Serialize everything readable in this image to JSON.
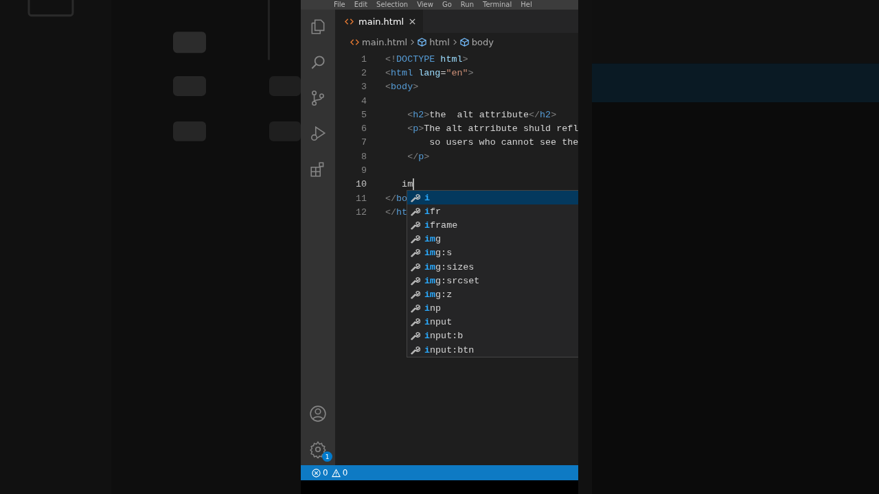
{
  "menu": [
    "File",
    "Edit",
    "Selection",
    "View",
    "Go",
    "Run",
    "Terminal",
    "Hel"
  ],
  "tabs": [
    {
      "label": "main.html",
      "selected": true
    }
  ],
  "breadcrumbs": [
    {
      "label": "main.html",
      "kind": "file"
    },
    {
      "label": "html",
      "kind": "element"
    },
    {
      "label": "body",
      "kind": "element"
    }
  ],
  "lines": [
    {
      "number": "1",
      "current": false,
      "segments": [
        {
          "kind": "punct",
          "text": "<!"
        },
        {
          "kind": "tag",
          "text": "DOCTYPE"
        },
        {
          "kind": "attr",
          "text": " html"
        },
        {
          "kind": "punct",
          "text": ">"
        }
      ]
    },
    {
      "number": "2",
      "current": false,
      "segments": [
        {
          "kind": "punct",
          "text": "<"
        },
        {
          "kind": "tag",
          "text": "html"
        },
        {
          "kind": "attr",
          "text": " lang"
        },
        {
          "kind": "text",
          "text": "="
        },
        {
          "kind": "str",
          "text": "\"en\""
        },
        {
          "kind": "punct",
          "text": ">"
        }
      ]
    },
    {
      "number": "3",
      "current": false,
      "segments": [
        {
          "kind": "punct",
          "text": "<"
        },
        {
          "kind": "tag",
          "text": "body"
        },
        {
          "kind": "punct",
          "text": ">"
        }
      ]
    },
    {
      "number": "4",
      "current": false
    },
    {
      "number": "5",
      "current": false,
      "segments": [
        {
          "kind": "punct",
          "text": "    <"
        },
        {
          "kind": "tag",
          "text": "h2"
        },
        {
          "kind": "punct",
          "text": ">"
        },
        {
          "kind": "text",
          "text": "the  alt attribute"
        },
        {
          "kind": "punct",
          "text": "</"
        },
        {
          "kind": "tag",
          "text": "h2"
        },
        {
          "kind": "punct",
          "text": ">"
        }
      ]
    },
    {
      "number": "6",
      "current": false,
      "segments": [
        {
          "kind": "punct",
          "text": "    <"
        },
        {
          "kind": "tag",
          "text": "p"
        },
        {
          "kind": "punct",
          "text": ">"
        },
        {
          "kind": "text",
          "text": "The alt atrribute shuld refl"
        }
      ]
    },
    {
      "number": "7",
      "current": false,
      "segments": [
        {
          "kind": "text",
          "text": "        so users who cannot see the"
        }
      ]
    },
    {
      "number": "8",
      "current": false,
      "segments": [
        {
          "kind": "punct",
          "text": "    </"
        },
        {
          "kind": "tag",
          "text": "p"
        },
        {
          "kind": "punct",
          "text": ">"
        }
      ]
    },
    {
      "number": "9",
      "current": false
    },
    {
      "number": "10",
      "current": true,
      "segments": [
        {
          "kind": "text",
          "text": "   im"
        }
      ]
    },
    {
      "number": "11",
      "current": false,
      "segments": [
        {
          "kind": "punct",
          "text": "</"
        },
        {
          "kind": "tag",
          "text": "bo"
        }
      ]
    },
    {
      "number": "12",
      "current": false,
      "segments": [
        {
          "kind": "punct",
          "text": "</"
        },
        {
          "kind": "tag",
          "text": "ht"
        }
      ]
    }
  ],
  "suggestions": [
    {
      "match": "i",
      "selected": true
    },
    {
      "match": "i",
      "rest": "fr",
      "selected": false
    },
    {
      "match": "i",
      "rest": "frame",
      "selected": false
    },
    {
      "match": "im",
      "rest": "g",
      "selected": false
    },
    {
      "match": "im",
      "rest": "g:s",
      "selected": false
    },
    {
      "match": "im",
      "rest": "g:sizes",
      "selected": false
    },
    {
      "match": "im",
      "rest": "g:srcset",
      "selected": false
    },
    {
      "match": "im",
      "rest": "g:z",
      "selected": false
    },
    {
      "match": "i",
      "rest": "np",
      "selected": false
    },
    {
      "match": "i",
      "rest": "nput",
      "selected": false
    },
    {
      "match": "i",
      "rest": "nput:b",
      "selected": false
    },
    {
      "match": "i",
      "rest": "nput:btn",
      "selected": false
    }
  ],
  "settings_badge": "1",
  "status_bar": {
    "errors": "0",
    "warnings": "0"
  }
}
